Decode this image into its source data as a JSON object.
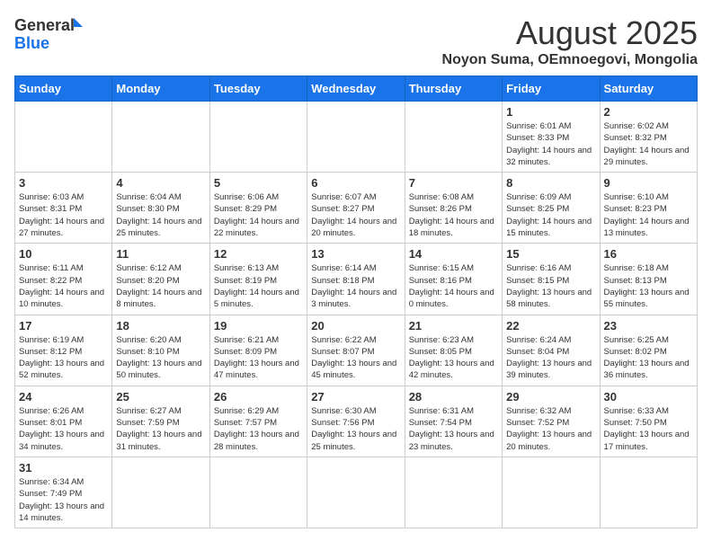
{
  "header": {
    "logo_general": "General",
    "logo_blue": "Blue",
    "month_title": "August 2025",
    "location": "Noyon Suma, OEmnoegovi, Mongolia"
  },
  "days_of_week": [
    "Sunday",
    "Monday",
    "Tuesday",
    "Wednesday",
    "Thursday",
    "Friday",
    "Saturday"
  ],
  "weeks": [
    [
      {
        "day": "",
        "info": ""
      },
      {
        "day": "",
        "info": ""
      },
      {
        "day": "",
        "info": ""
      },
      {
        "day": "",
        "info": ""
      },
      {
        "day": "",
        "info": ""
      },
      {
        "day": "1",
        "info": "Sunrise: 6:01 AM\nSunset: 8:33 PM\nDaylight: 14 hours and 32 minutes."
      },
      {
        "day": "2",
        "info": "Sunrise: 6:02 AM\nSunset: 8:32 PM\nDaylight: 14 hours and 29 minutes."
      }
    ],
    [
      {
        "day": "3",
        "info": "Sunrise: 6:03 AM\nSunset: 8:31 PM\nDaylight: 14 hours and 27 minutes."
      },
      {
        "day": "4",
        "info": "Sunrise: 6:04 AM\nSunset: 8:30 PM\nDaylight: 14 hours and 25 minutes."
      },
      {
        "day": "5",
        "info": "Sunrise: 6:06 AM\nSunset: 8:29 PM\nDaylight: 14 hours and 22 minutes."
      },
      {
        "day": "6",
        "info": "Sunrise: 6:07 AM\nSunset: 8:27 PM\nDaylight: 14 hours and 20 minutes."
      },
      {
        "day": "7",
        "info": "Sunrise: 6:08 AM\nSunset: 8:26 PM\nDaylight: 14 hours and 18 minutes."
      },
      {
        "day": "8",
        "info": "Sunrise: 6:09 AM\nSunset: 8:25 PM\nDaylight: 14 hours and 15 minutes."
      },
      {
        "day": "9",
        "info": "Sunrise: 6:10 AM\nSunset: 8:23 PM\nDaylight: 14 hours and 13 minutes."
      }
    ],
    [
      {
        "day": "10",
        "info": "Sunrise: 6:11 AM\nSunset: 8:22 PM\nDaylight: 14 hours and 10 minutes."
      },
      {
        "day": "11",
        "info": "Sunrise: 6:12 AM\nSunset: 8:20 PM\nDaylight: 14 hours and 8 minutes."
      },
      {
        "day": "12",
        "info": "Sunrise: 6:13 AM\nSunset: 8:19 PM\nDaylight: 14 hours and 5 minutes."
      },
      {
        "day": "13",
        "info": "Sunrise: 6:14 AM\nSunset: 8:18 PM\nDaylight: 14 hours and 3 minutes."
      },
      {
        "day": "14",
        "info": "Sunrise: 6:15 AM\nSunset: 8:16 PM\nDaylight: 14 hours and 0 minutes."
      },
      {
        "day": "15",
        "info": "Sunrise: 6:16 AM\nSunset: 8:15 PM\nDaylight: 13 hours and 58 minutes."
      },
      {
        "day": "16",
        "info": "Sunrise: 6:18 AM\nSunset: 8:13 PM\nDaylight: 13 hours and 55 minutes."
      }
    ],
    [
      {
        "day": "17",
        "info": "Sunrise: 6:19 AM\nSunset: 8:12 PM\nDaylight: 13 hours and 52 minutes."
      },
      {
        "day": "18",
        "info": "Sunrise: 6:20 AM\nSunset: 8:10 PM\nDaylight: 13 hours and 50 minutes."
      },
      {
        "day": "19",
        "info": "Sunrise: 6:21 AM\nSunset: 8:09 PM\nDaylight: 13 hours and 47 minutes."
      },
      {
        "day": "20",
        "info": "Sunrise: 6:22 AM\nSunset: 8:07 PM\nDaylight: 13 hours and 45 minutes."
      },
      {
        "day": "21",
        "info": "Sunrise: 6:23 AM\nSunset: 8:05 PM\nDaylight: 13 hours and 42 minutes."
      },
      {
        "day": "22",
        "info": "Sunrise: 6:24 AM\nSunset: 8:04 PM\nDaylight: 13 hours and 39 minutes."
      },
      {
        "day": "23",
        "info": "Sunrise: 6:25 AM\nSunset: 8:02 PM\nDaylight: 13 hours and 36 minutes."
      }
    ],
    [
      {
        "day": "24",
        "info": "Sunrise: 6:26 AM\nSunset: 8:01 PM\nDaylight: 13 hours and 34 minutes."
      },
      {
        "day": "25",
        "info": "Sunrise: 6:27 AM\nSunset: 7:59 PM\nDaylight: 13 hours and 31 minutes."
      },
      {
        "day": "26",
        "info": "Sunrise: 6:29 AM\nSunset: 7:57 PM\nDaylight: 13 hours and 28 minutes."
      },
      {
        "day": "27",
        "info": "Sunrise: 6:30 AM\nSunset: 7:56 PM\nDaylight: 13 hours and 25 minutes."
      },
      {
        "day": "28",
        "info": "Sunrise: 6:31 AM\nSunset: 7:54 PM\nDaylight: 13 hours and 23 minutes."
      },
      {
        "day": "29",
        "info": "Sunrise: 6:32 AM\nSunset: 7:52 PM\nDaylight: 13 hours and 20 minutes."
      },
      {
        "day": "30",
        "info": "Sunrise: 6:33 AM\nSunset: 7:50 PM\nDaylight: 13 hours and 17 minutes."
      }
    ],
    [
      {
        "day": "31",
        "info": "Sunrise: 6:34 AM\nSunset: 7:49 PM\nDaylight: 13 hours and 14 minutes."
      },
      {
        "day": "",
        "info": ""
      },
      {
        "day": "",
        "info": ""
      },
      {
        "day": "",
        "info": ""
      },
      {
        "day": "",
        "info": ""
      },
      {
        "day": "",
        "info": ""
      },
      {
        "day": "",
        "info": ""
      }
    ]
  ]
}
